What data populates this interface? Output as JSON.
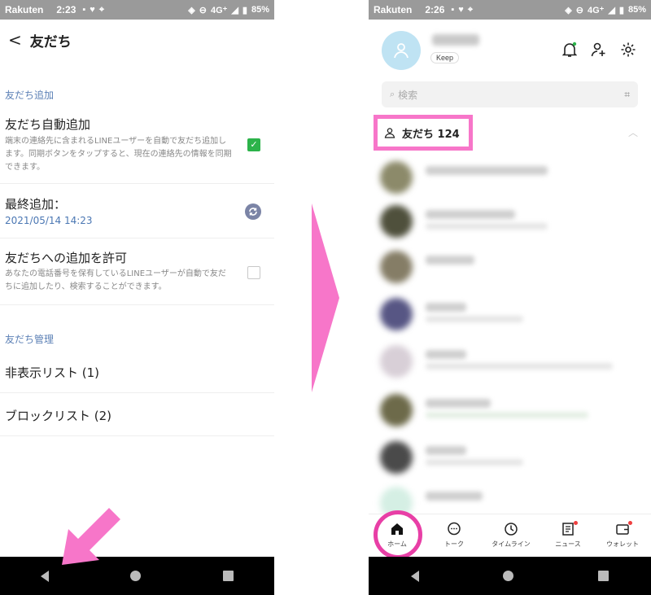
{
  "left_screen": {
    "status_bar": {
      "carrier": "Rakuten",
      "time": "2:23",
      "network": "4G⁺",
      "battery": "85%"
    },
    "header": {
      "back_icon": "chevron-left-icon",
      "title": "友だち"
    },
    "section_add": {
      "label": "友だち追加",
      "auto_add": {
        "title": "友だち自動追加",
        "description": "端末の連絡先に含まれるLINEユーザーを自動で友だち追加します。同期ボタンをタップすると、現在の連絡先の情報を同期できます。",
        "checked": true
      },
      "last_added": {
        "title": "最終追加：",
        "date": "2021/05/14 14:23"
      },
      "allow_add": {
        "title": "友だちへの追加を許可",
        "description": "あなたの電話番号を保有しているLINEユーザーが自動で友だちに追加したり、検索することができます。",
        "checked": false
      }
    },
    "section_manage": {
      "label": "友だち管理",
      "hidden_list": "非表示リスト (1)",
      "block_list": "ブロックリスト (2)"
    }
  },
  "right_screen": {
    "status_bar": {
      "carrier": "Rakuten",
      "time": "2:26",
      "network": "4G⁺",
      "battery": "85%"
    },
    "profile": {
      "keep_label": "Keep"
    },
    "search": {
      "placeholder": "検索"
    },
    "friends_header": {
      "label": "友だち 124"
    },
    "tabs": [
      {
        "label": "ホーム",
        "icon": "home-icon"
      },
      {
        "label": "トーク",
        "icon": "chat-icon"
      },
      {
        "label": "タイムライン",
        "icon": "clock-icon"
      },
      {
        "label": "ニュース",
        "icon": "news-icon"
      },
      {
        "label": "ウォレット",
        "icon": "wallet-icon"
      }
    ]
  },
  "colors": {
    "accent_pink": "#f776c9",
    "highlight_pink": "#e83fa6",
    "line_green": "#2cb34a",
    "link_blue": "#4b77b3"
  }
}
